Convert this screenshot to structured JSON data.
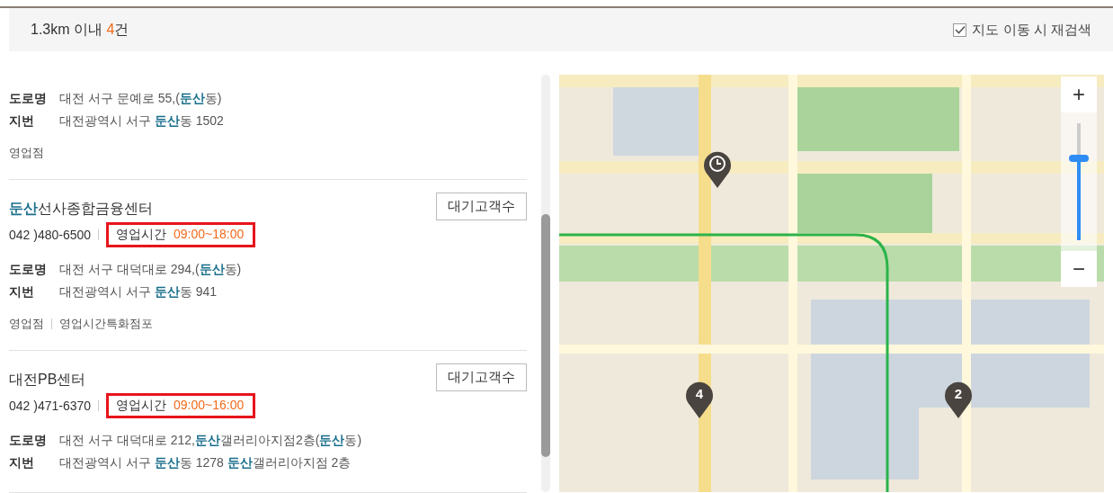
{
  "header": {
    "radius": "1.3km 이내",
    "count": "4",
    "unit": "건",
    "recheck": {
      "label": "지도 이동 시 재검색",
      "checked": true
    }
  },
  "branches": [
    {
      "road_label": "도로명",
      "road": "대전 서구 문예로 55,(**둔산**동)",
      "lot_label": "지번",
      "lot": "대전광역시 서구 **둔산**동 1502",
      "tags": [
        "영업점"
      ]
    },
    {
      "name": "**둔산**선사종합금융센터",
      "phone": "042 )480-6500",
      "hours_label": "영업시간",
      "hours": "09:00~18:00",
      "button": "대기고객수",
      "road_label": "도로명",
      "road": "대전 서구 대덕대로 294,(**둔산**동)",
      "lot_label": "지번",
      "lot": "대전광역시 서구 **둔산**동 941",
      "tags": [
        "영업점",
        "영업시간특화점포"
      ]
    },
    {
      "name": "대전PB센터",
      "phone": "042 )471-6370",
      "hours_label": "영업시간",
      "hours": "09:00~16:00",
      "button": "대기고객수",
      "road_label": "도로명",
      "road": "대전 서구 대덕대로 212,**둔산**갤러리아지점2층(**둔산**동)",
      "lot_label": "지번",
      "lot": "대전광역시 서구 **둔산**동 1278 **둔산**갤러리아지점 2층"
    }
  ],
  "map": {
    "kind": "picture",
    "markers": [
      {
        "kind": "clock"
      },
      {
        "kind": "number",
        "label": "4"
      },
      {
        "kind": "number",
        "label": "2"
      }
    ],
    "zoom": {
      "in": "+",
      "out": "−",
      "level": 0.7
    }
  }
}
